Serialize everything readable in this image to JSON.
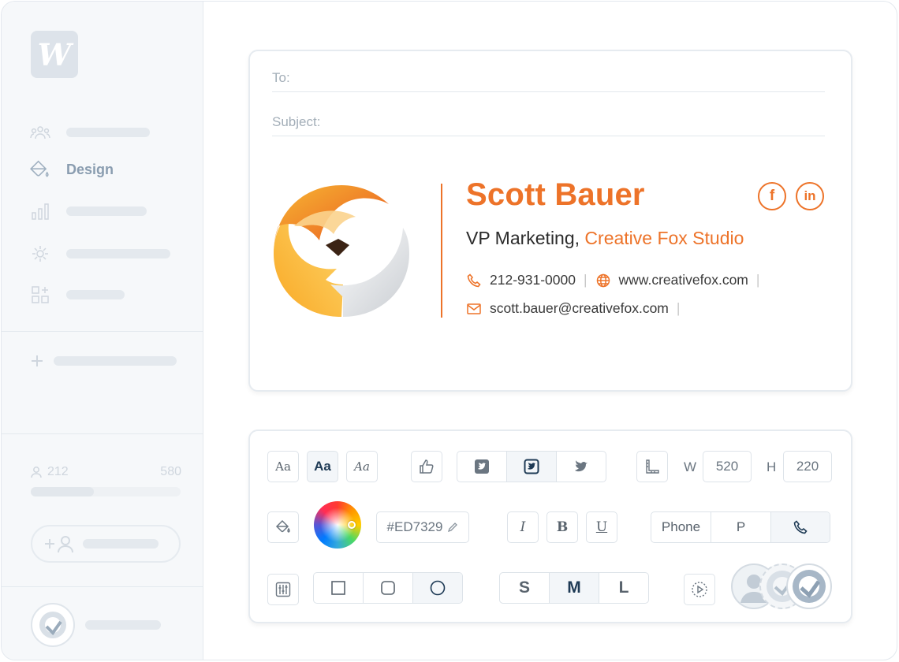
{
  "sidebar": {
    "logo_letter": "W",
    "active_item": "Design",
    "stats": {
      "left_value": "212",
      "right_value": "580",
      "progress_fraction": 0.42
    }
  },
  "email": {
    "to_label": "To:",
    "subject_label": "Subject:"
  },
  "signature": {
    "name": "Scott Bauer",
    "title": "VP Marketing, ",
    "company": "Creative Fox Studio",
    "phone": "212-931-0000",
    "website": "www.creativefox.com",
    "email": "scott.bauer@creativefox.com",
    "separator": "|",
    "accent_color": "#ED7329",
    "social": {
      "facebook": "f",
      "linkedin": "in"
    }
  },
  "toolbar": {
    "font_buttons": [
      "Aa",
      "Aa",
      "Aa"
    ],
    "width_label": "W",
    "width_value": "520",
    "height_label": "H",
    "height_value": "220",
    "hex_value": "#ED7329",
    "italic": "I",
    "bold": "B",
    "underline": "U",
    "phone_formats": [
      "Phone",
      "P"
    ],
    "sizes": [
      "S",
      "M",
      "L"
    ],
    "selected_size": "M"
  }
}
